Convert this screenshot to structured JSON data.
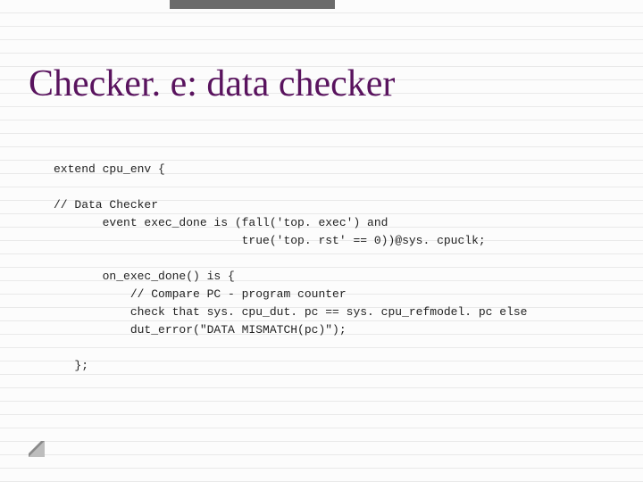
{
  "title": "Checker. e: data checker",
  "code": {
    "l1": "extend cpu_env {",
    "l2": "",
    "l3": "// Data Checker",
    "l4": "       event exec_done is (fall('top. exec') and",
    "l5": "                           true('top. rst' == 0))@sys. cpuclk;",
    "l6": "",
    "l7": "       on_exec_done() is {",
    "l8": "           // Compare PC - program counter",
    "l9": "           check that sys. cpu_dut. pc == sys. cpu_refmodel. pc else",
    "l10": "           dut_error(\"DATA MISMATCH(pc)\");",
    "l11": "",
    "l12": "   };"
  }
}
